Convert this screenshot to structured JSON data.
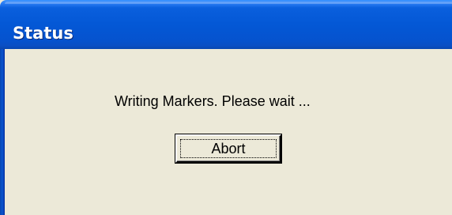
{
  "window": {
    "title": "Status"
  },
  "dialog": {
    "message": "Writing Markers. Please wait ...",
    "abort_label": "Abort"
  },
  "colors": {
    "titlebar_blue": "#0458d6",
    "dialog_background": "#ece9d8",
    "title_text": "#ffffff"
  }
}
